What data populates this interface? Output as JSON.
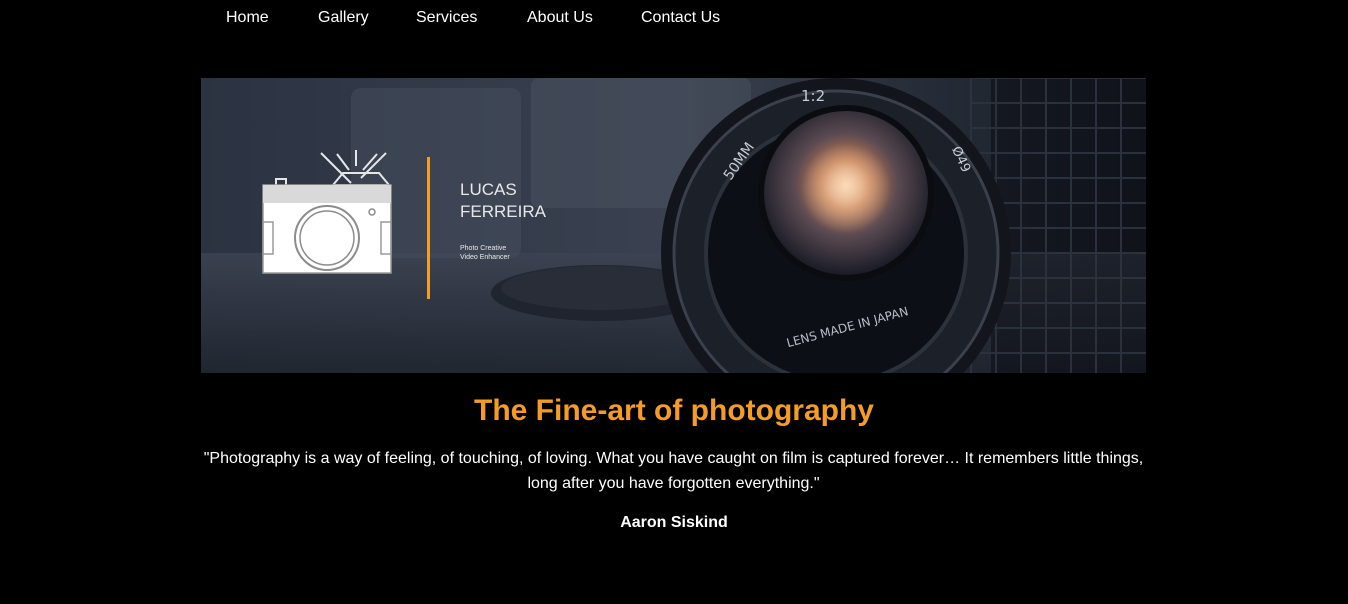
{
  "nav": {
    "items": [
      {
        "label": "Home"
      },
      {
        "label": "Gallery"
      },
      {
        "label": "Services"
      },
      {
        "label": "About Us"
      },
      {
        "label": "Contact Us"
      }
    ]
  },
  "banner": {
    "name_line1": "LUCAS",
    "name_line2": "FERREIRA",
    "tagline_line1": "Photo Creative",
    "tagline_line2": "Video Enhancer",
    "lens_text_top": "1:2",
    "lens_text_left": "50MM",
    "lens_text_right": "Ø49",
    "lens_text_bottom": "LENS MADE IN JAPAN",
    "accent_color": "#f39c26"
  },
  "main": {
    "title": "The Fine-art of photography",
    "quote": "\"Photography is a way of feeling, of touching, of loving. What you have caught on film is captured forever… It remembers little things, long after you have forgotten everything.\"",
    "author": "Aaron Siskind",
    "title_color": "#f39c26"
  }
}
